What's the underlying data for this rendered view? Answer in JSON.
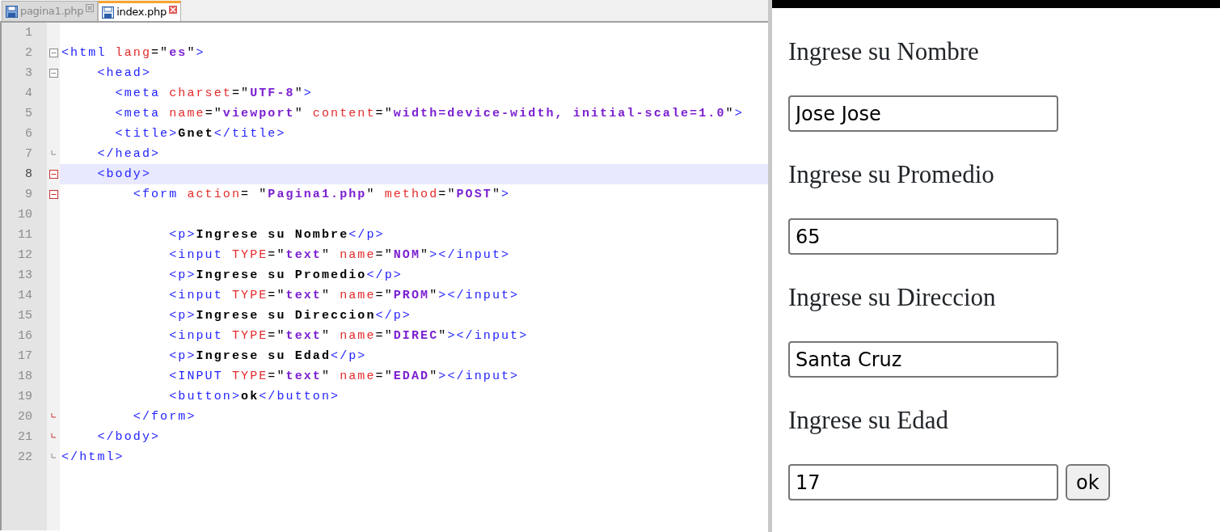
{
  "editor": {
    "tabs": [
      {
        "label": "pagina1.php",
        "selected": false
      },
      {
        "label": "index.php",
        "selected": true
      }
    ],
    "lines": [
      {
        "number": "1",
        "kind": "plain",
        "selected": false
      },
      {
        "number": "2",
        "kind": "fold-open",
        "selected": false,
        "tokens": [
          {
            "kind": "tag",
            "text": "<html "
          },
          {
            "kind": "attr",
            "text": "lang"
          },
          {
            "kind": "plain",
            "text": "=\""
          },
          {
            "kind": "value",
            "text": "es"
          },
          {
            "kind": "plain",
            "text": "\""
          },
          {
            "kind": "tag",
            "text": ">"
          }
        ]
      },
      {
        "number": "3",
        "kind": "fold-open",
        "selected": false,
        "tokens": [
          {
            "kind": "tag",
            "text": "    <head>"
          }
        ]
      },
      {
        "number": "4",
        "kind": "plain",
        "selected": false,
        "tokens": [
          {
            "kind": "tag",
            "text": "      <meta "
          },
          {
            "kind": "attr",
            "text": "charset"
          },
          {
            "kind": "plain",
            "text": "=\""
          },
          {
            "kind": "value",
            "text": "UTF-8"
          },
          {
            "kind": "plain",
            "text": "\""
          },
          {
            "kind": "tag",
            "text": ">"
          }
        ]
      },
      {
        "number": "5",
        "kind": "plain",
        "selected": false,
        "tokens": [
          {
            "kind": "tag",
            "text": "      <meta "
          },
          {
            "kind": "attr",
            "text": "name"
          },
          {
            "kind": "plain",
            "text": "=\""
          },
          {
            "kind": "value",
            "text": "viewport"
          },
          {
            "kind": "plain",
            "text": "\" "
          },
          {
            "kind": "attr",
            "text": "content"
          },
          {
            "kind": "plain",
            "text": "=\""
          },
          {
            "kind": "value",
            "text": "width=device-width, initial-scale=1.0"
          },
          {
            "kind": "plain",
            "text": "\""
          },
          {
            "kind": "tag",
            "text": ">"
          }
        ]
      },
      {
        "number": "6",
        "kind": "plain",
        "selected": false,
        "tokens": [
          {
            "kind": "tag",
            "text": "      <title>"
          },
          {
            "kind": "text",
            "text": "Gnet"
          },
          {
            "kind": "tag",
            "text": "</title>"
          }
        ]
      },
      {
        "number": "7",
        "kind": "fold-end",
        "selected": false,
        "tokens": [
          {
            "kind": "tag",
            "text": "    </head>"
          }
        ]
      },
      {
        "number": "8",
        "kind": "fold-open",
        "selected": true,
        "tokens": [
          {
            "kind": "tag",
            "text": "    <body>"
          }
        ]
      },
      {
        "number": "9",
        "kind": "fold-open",
        "selected": false,
        "tokens": [
          {
            "kind": "tag",
            "text": "        <form "
          },
          {
            "kind": "attr",
            "text": "action"
          },
          {
            "kind": "plain",
            "text": "= \""
          },
          {
            "kind": "value",
            "text": "Pagina1.php"
          },
          {
            "kind": "plain",
            "text": "\" "
          },
          {
            "kind": "attr",
            "text": "method"
          },
          {
            "kind": "plain",
            "text": "=\""
          },
          {
            "kind": "value",
            "text": "POST"
          },
          {
            "kind": "plain",
            "text": "\""
          },
          {
            "kind": "tag",
            "text": ">"
          }
        ]
      },
      {
        "number": "10",
        "kind": "plain",
        "selected": false
      },
      {
        "number": "11",
        "kind": "plain",
        "selected": false,
        "tokens": [
          {
            "kind": "tag",
            "text": "            <p>"
          },
          {
            "kind": "text",
            "text": "Ingrese su Nombre"
          },
          {
            "kind": "tag",
            "text": "</p>"
          }
        ]
      },
      {
        "number": "12",
        "kind": "plain",
        "selected": false,
        "tokens": [
          {
            "kind": "tag",
            "text": "            <input "
          },
          {
            "kind": "attr",
            "text": "TYPE"
          },
          {
            "kind": "plain",
            "text": "=\""
          },
          {
            "kind": "value",
            "text": "text"
          },
          {
            "kind": "plain",
            "text": "\" "
          },
          {
            "kind": "attr",
            "text": "name"
          },
          {
            "kind": "plain",
            "text": "=\""
          },
          {
            "kind": "value",
            "text": "NOM"
          },
          {
            "kind": "plain",
            "text": "\""
          },
          {
            "kind": "tag",
            "text": "></input>"
          }
        ]
      },
      {
        "number": "13",
        "kind": "plain",
        "selected": false,
        "tokens": [
          {
            "kind": "tag",
            "text": "            <p>"
          },
          {
            "kind": "text",
            "text": "Ingrese su Promedio"
          },
          {
            "kind": "tag",
            "text": "</p>"
          }
        ]
      },
      {
        "number": "14",
        "kind": "plain",
        "selected": false,
        "tokens": [
          {
            "kind": "tag",
            "text": "            <input "
          },
          {
            "kind": "attr",
            "text": "TYPE"
          },
          {
            "kind": "plain",
            "text": "=\""
          },
          {
            "kind": "value",
            "text": "text"
          },
          {
            "kind": "plain",
            "text": "\" "
          },
          {
            "kind": "attr",
            "text": "name"
          },
          {
            "kind": "plain",
            "text": "=\""
          },
          {
            "kind": "value",
            "text": "PROM"
          },
          {
            "kind": "plain",
            "text": "\""
          },
          {
            "kind": "tag",
            "text": "></input>"
          }
        ]
      },
      {
        "number": "15",
        "kind": "plain",
        "selected": false,
        "tokens": [
          {
            "kind": "tag",
            "text": "            <p>"
          },
          {
            "kind": "text",
            "text": "Ingrese su Direccion"
          },
          {
            "kind": "tag",
            "text": "</p>"
          }
        ]
      },
      {
        "number": "16",
        "kind": "plain",
        "selected": false,
        "tokens": [
          {
            "kind": "tag",
            "text": "            <input "
          },
          {
            "kind": "attr",
            "text": "TYPE"
          },
          {
            "kind": "plain",
            "text": "=\""
          },
          {
            "kind": "value",
            "text": "text"
          },
          {
            "kind": "plain",
            "text": "\" "
          },
          {
            "kind": "attr",
            "text": "name"
          },
          {
            "kind": "plain",
            "text": "=\""
          },
          {
            "kind": "value",
            "text": "DIREC"
          },
          {
            "kind": "plain",
            "text": "\""
          },
          {
            "kind": "tag",
            "text": "></input>"
          }
        ]
      },
      {
        "number": "17",
        "kind": "plain",
        "selected": false,
        "tokens": [
          {
            "kind": "tag",
            "text": "            <p>"
          },
          {
            "kind": "text",
            "text": "Ingrese su Edad"
          },
          {
            "kind": "tag",
            "text": "</p>"
          }
        ]
      },
      {
        "number": "18",
        "kind": "plain",
        "selected": false,
        "tokens": [
          {
            "kind": "tag",
            "text": "            <INPUT "
          },
          {
            "kind": "attr",
            "text": "TYPE"
          },
          {
            "kind": "plain",
            "text": "=\""
          },
          {
            "kind": "value",
            "text": "text"
          },
          {
            "kind": "plain",
            "text": "\" "
          },
          {
            "kind": "attr",
            "text": "name"
          },
          {
            "kind": "plain",
            "text": "=\""
          },
          {
            "kind": "value",
            "text": "EDAD"
          },
          {
            "kind": "plain",
            "text": "\""
          },
          {
            "kind": "tag",
            "text": "></input>"
          }
        ]
      },
      {
        "number": "19",
        "kind": "plain",
        "selected": false,
        "tokens": [
          {
            "kind": "tag",
            "text": "            <button>"
          },
          {
            "kind": "text",
            "text": "ok"
          },
          {
            "kind": "tag",
            "text": "</button>"
          }
        ]
      },
      {
        "number": "20",
        "kind": "fold-end",
        "selected": false,
        "tokens": [
          {
            "kind": "tag",
            "text": "        </form>"
          }
        ]
      },
      {
        "number": "21",
        "kind": "fold-end",
        "selected": false,
        "tokens": [
          {
            "kind": "tag",
            "text": "    </body>"
          }
        ]
      },
      {
        "number": "22",
        "kind": "fold-last",
        "selected": false,
        "tokens": [
          {
            "kind": "tag",
            "text": "</html>"
          }
        ]
      }
    ]
  },
  "preview": {
    "fields": [
      {
        "label": "Ingrese su Nombre",
        "value": "Jose Jose"
      },
      {
        "label": "Ingrese su Promedio",
        "value": "65"
      },
      {
        "label": "Ingrese su Direccion",
        "value": "Santa Cruz"
      },
      {
        "label": "Ingrese su Edad",
        "value": "17"
      }
    ],
    "button": "ok"
  }
}
